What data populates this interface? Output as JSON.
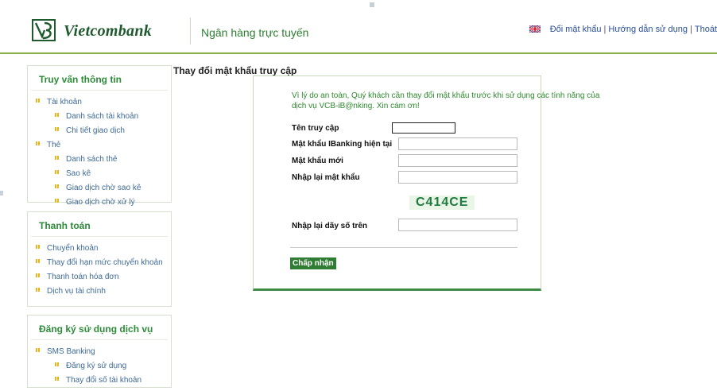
{
  "header": {
    "bank_name": "Vietcombank",
    "tagline": "Ngân hàng trực tuyến",
    "links": [
      "Đổi mật khẩu",
      "Hướng dẫn sử dụng",
      "Thoát"
    ]
  },
  "sidebar": {
    "sections": [
      {
        "title": "Truy vấn thông tin",
        "items": [
          {
            "label": "Tài khoản",
            "level": 1
          },
          {
            "label": "Danh sách tài khoản",
            "level": 2
          },
          {
            "label": "Chi tiết giao dịch",
            "level": 2
          },
          {
            "label": "Thẻ",
            "level": 1
          },
          {
            "label": "Danh sách thẻ",
            "level": 2
          },
          {
            "label": "Sao kê",
            "level": 2
          },
          {
            "label": "Giao dịch chờ sao kê",
            "level": 2
          },
          {
            "label": "Giao dịch chờ xử lý",
            "level": 2
          }
        ]
      },
      {
        "title": "Thanh toán",
        "items": [
          {
            "label": "Chuyển khoản",
            "level": 1
          },
          {
            "label": "Thay đổi hạn mức chuyển khoản",
            "level": 1
          },
          {
            "label": "Thanh toán hóa đơn",
            "level": 1
          },
          {
            "label": "Dịch vụ tài chính",
            "level": 1
          }
        ]
      },
      {
        "title": "Đăng ký sử dụng dịch vụ",
        "items": [
          {
            "label": "SMS Banking",
            "level": 1
          },
          {
            "label": "Đăng ký sử dụng",
            "level": 2
          },
          {
            "label": "Thay đổi số tài khoản",
            "level": 2
          }
        ]
      }
    ]
  },
  "main": {
    "title": "Thay đổi mật khẩu truy cập",
    "notice": "Vì lý do an toàn, Quý khách cần thay đổi mật khẩu trước khi sử dụng các tính năng của dịch vụ VCB-iB@nking. Xin cám ơn!",
    "form": {
      "username_label": "Tên truy cập",
      "username_value": "",
      "current_password_label": "Mật khẩu IBanking hiện tại",
      "new_password_label": "Mật khẩu mới",
      "confirm_password_label": "Nhập lại mật khẩu",
      "captcha": "C414CE",
      "captcha_label": "Nhập lại dãy số trên",
      "submit_label": "Chấp nhận"
    }
  },
  "colors": {
    "brand_green": "#2e7d32",
    "link_blue": "#2b4f9a",
    "bullet_yellow": "#e8b51c"
  }
}
